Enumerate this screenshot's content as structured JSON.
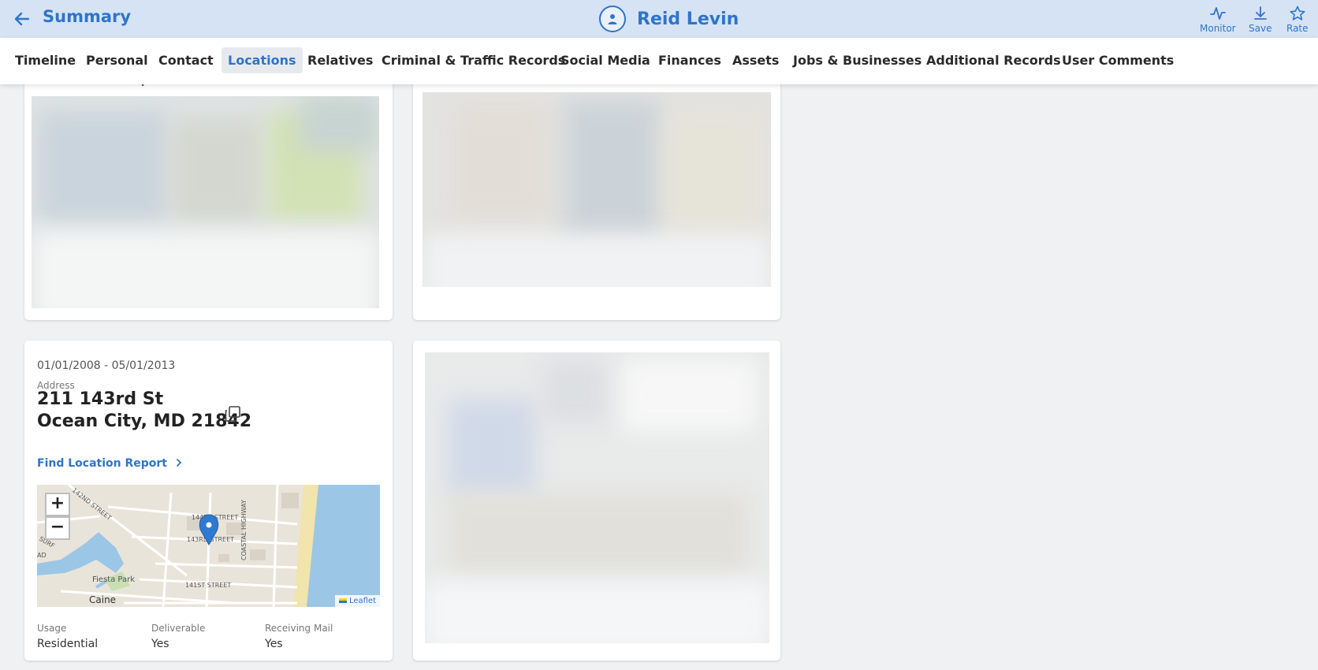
{
  "header": {
    "back_icon": "arrow-left-icon",
    "title": "Summary",
    "person_icon": "user-circle-icon",
    "person_name": "Reid Levin",
    "actions": [
      {
        "label": "Monitor",
        "icon": "activity-icon"
      },
      {
        "label": "Save",
        "icon": "download-icon"
      },
      {
        "label": "Rate",
        "icon": "star-icon"
      }
    ]
  },
  "tabs": [
    {
      "label": "Timeline"
    },
    {
      "label": "Personal"
    },
    {
      "label": "Contact"
    },
    {
      "label": "Locations",
      "active": true
    },
    {
      "label": "Relatives"
    },
    {
      "label": "Criminal & Traffic Records"
    },
    {
      "label": "Social Media"
    },
    {
      "label": "Finances"
    },
    {
      "label": "Assets"
    },
    {
      "label": "Jobs & Businesses"
    },
    {
      "label": "Additional Records"
    },
    {
      "label": "User Comments"
    }
  ],
  "top_card_left": {
    "link_peek": "Find Location Report"
  },
  "location": {
    "date_range": "01/01/2008 - 05/01/2013",
    "address_label": "Address",
    "address_line1": "211 143rd St",
    "address_line2": "Ocean City, MD 21842",
    "copy_icon": "copy-icon",
    "find_report": "Find Location Report",
    "find_report_icon": "chevron-right-icon",
    "map": {
      "zoom_in": "+",
      "zoom_out": "−",
      "attribution": "Leaflet",
      "labels": {
        "s142": "142ND STREET",
        "s143": "143RD STREET",
        "s144": "144TH STREET",
        "s141": "141ST STREET",
        "coastal": "COASTAL HIGHWAY",
        "park": "Fiesta Park",
        "caine": "Caine",
        "surf": "SURF",
        "ad": "AD"
      },
      "marker_icon": "map-pin-icon"
    },
    "stats": [
      {
        "label": "Usage",
        "value": "Residential"
      },
      {
        "label": "Deliverable",
        "value": "Yes"
      },
      {
        "label": "Receiving Mail",
        "value": "Yes"
      }
    ]
  },
  "colors": {
    "accent": "#2f74c9",
    "header_bg": "#d6e3f5",
    "page_bg": "#f0f1f3",
    "water": "#8fbde0"
  }
}
